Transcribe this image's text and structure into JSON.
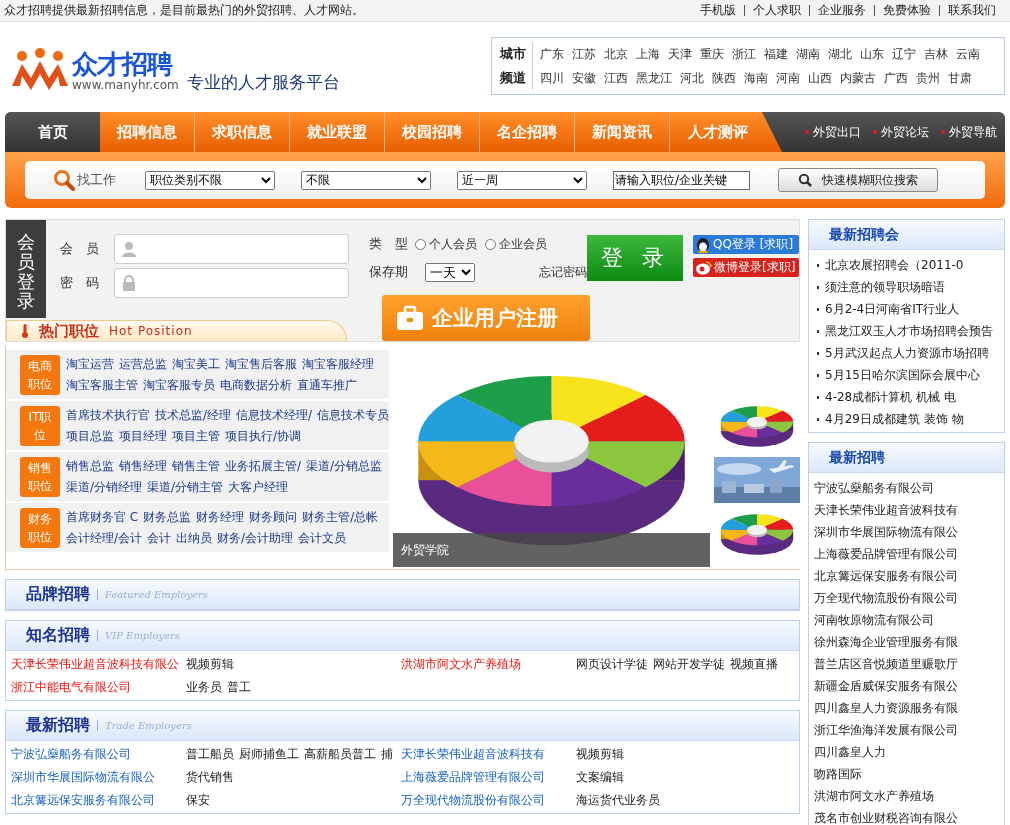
{
  "top_bar": {
    "slogan": "众才招聘提供最新招聘信息，是目前最热门的外贸招聘、人才网站。",
    "links": [
      "手机版",
      "个人求职",
      "企业服务",
      "免费体验",
      "联系我们"
    ]
  },
  "header": {
    "logo_name": "众才招聘",
    "logo_url": "www.manyhr.com",
    "tagline": "专业的人才服务平台",
    "channels": [
      {
        "label": "城市",
        "items": [
          "广东",
          "江苏",
          "北京",
          "上海",
          "天津",
          "重庆",
          "浙江",
          "福建",
          "湖南",
          "湖北",
          "山东",
          "辽宁",
          "吉林",
          "云南"
        ]
      },
      {
        "label": "频道",
        "items": [
          "四川",
          "安徽",
          "江西",
          "黑龙江",
          "河北",
          "陕西",
          "海南",
          "河南",
          "山西",
          "内蒙古",
          "广西",
          "贵州",
          "甘肃"
        ]
      }
    ]
  },
  "nav": {
    "items": [
      {
        "label": "首页",
        "selected": true
      },
      {
        "label": "招聘信息",
        "selected": false
      },
      {
        "label": "求职信息",
        "selected": false
      },
      {
        "label": "就业联盟",
        "selected": false
      },
      {
        "label": "校园招聘",
        "selected": false
      },
      {
        "label": "名企招聘",
        "selected": false
      },
      {
        "label": "新闻资讯",
        "selected": false
      },
      {
        "label": "人才测评",
        "selected": false
      }
    ],
    "extra_links": [
      "外贸出口",
      "外贸论坛",
      "外贸导航"
    ]
  },
  "search": {
    "label": "找工作",
    "selects": [
      "职位类别不限",
      "不限",
      "近一周"
    ],
    "keyword": "请输入职位/企业关键",
    "button": "快速模糊职位搜索"
  },
  "login": {
    "title": "会员登录",
    "user_label": "会　员",
    "password_label": "密　码",
    "type_label": "类　型",
    "types": [
      {
        "label": "个人会员",
        "selected": false
      },
      {
        "label": "企业会员",
        "selected": false
      }
    ],
    "keep_label": "保存期",
    "keep_value": "一天",
    "forgot": "忘记密码",
    "login_button": "登 录",
    "qq_login": "QQ登录 [求职]",
    "weibo_login": "微博登录[求职]",
    "register_button": "企业用户注册"
  },
  "hot_tab": {
    "title": "热门职位",
    "subtitle": "Hot Position"
  },
  "categories": [
    {
      "label": "电商职位",
      "jobs": [
        "淘宝运营",
        "运营总监",
        "淘宝美工",
        "淘宝售后客服",
        "淘宝客服经理",
        "淘宝客服主管",
        "淘宝客服专员",
        "电商数据分析",
        "直通车推广"
      ]
    },
    {
      "label": "IT职位",
      "jobs": [
        "首席技术执行官",
        "技术总监/经理",
        "信息技术经理/",
        "信息技术专员",
        "项目总监",
        "项目经理",
        "项目主管",
        "项目执行/协调"
      ]
    },
    {
      "label": "销售职位",
      "jobs": [
        "销售总监",
        "销售经理",
        "销售主管",
        "业务拓展主管/",
        "渠道/分销总监",
        "渠道/分销经理",
        "渠道/分销主管",
        "大客户经理"
      ]
    },
    {
      "label": "财务职位",
      "jobs": [
        "首席财务官 C",
        "财务总监",
        "财务经理",
        "财务顾问",
        "财务主管/总帐",
        "会计经理/会计",
        "会计",
        "出纳员",
        "财务/会计助理",
        "会计文员"
      ]
    }
  ],
  "feature": {
    "caption": "外贸学院"
  },
  "sections": [
    {
      "kind": "brand",
      "title": "品牌招聘",
      "subtitle": "Featured Employers"
    },
    {
      "kind": "vip",
      "title": "知名招聘",
      "subtitle": "VIP Employers",
      "rows": [
        {
          "company": "天津长荣伟业超音波科技有限公",
          "jobs": [
            "视频剪辑"
          ]
        },
        {
          "company": "洪湖市阿文水产养殖场",
          "jobs": [
            "网页设计学徒",
            "网站开发学徒",
            "视频直播"
          ]
        },
        {
          "company": "浙江中能电气有限公司",
          "jobs": [
            "业务员",
            "普工"
          ]
        }
      ]
    },
    {
      "kind": "latest",
      "title": "最新招聘",
      "subtitle": "Trade Employers",
      "rows": [
        {
          "company": "宁波弘燊船务有限公司",
          "jobs": [
            "普工船员",
            "厨师捕鱼工",
            "高薪船员普工",
            "捕"
          ]
        },
        {
          "company": "天津长荣伟业超音波科技有",
          "jobs": [
            "视频剪辑"
          ]
        },
        {
          "company": "深圳市华展国际物流有限公",
          "jobs": [
            "货代销售"
          ]
        },
        {
          "company": "上海薇爱品牌管理有限公司",
          "jobs": [
            "文案编辑"
          ]
        },
        {
          "company": "北京篝远保安服务有限公司",
          "jobs": [
            "保安"
          ]
        },
        {
          "company": "万全现代物流股份有限公司",
          "jobs": [
            "海运货代业务员"
          ]
        }
      ]
    }
  ],
  "sidebar": [
    {
      "kind": "bullets",
      "title": "最新招聘会",
      "items": [
        "北京农展招聘会（2011-0",
        "须注意的领导职场暗语",
        "6月2-4日河南省IT行业人",
        "黑龙江双玉人才市场招聘会预告",
        "5月武汉起点人力资源市场招聘",
        "5月15日哈尔滨国际会展中心",
        "4-28成都计算机 机械 电",
        "4月29日成都建筑 装饰 物"
      ]
    },
    {
      "kind": "plain",
      "title": "最新招聘",
      "items": [
        "宁波弘燊船务有限公司",
        "天津长荣伟业超音波科技有",
        "深圳市华展国际物流有限公",
        "上海薇爱品牌管理有限公司",
        "北京篝远保安服务有限公司",
        "万全现代物流股份有限公司",
        "河南牧原物流有限公司",
        "徐州森海企业管理服务有限",
        "普兰店区音悦频道里赈歌厅",
        "新疆金盾威保安服务有限公",
        "四川鑫皇人力资源服务有限",
        "浙江华渔海洋发展有限公司",
        "四川鑫皇人力",
        "吻路国际",
        "洪湖市阿文水产养殖场",
        "茂名市创业财税咨询有限公"
      ]
    }
  ]
}
